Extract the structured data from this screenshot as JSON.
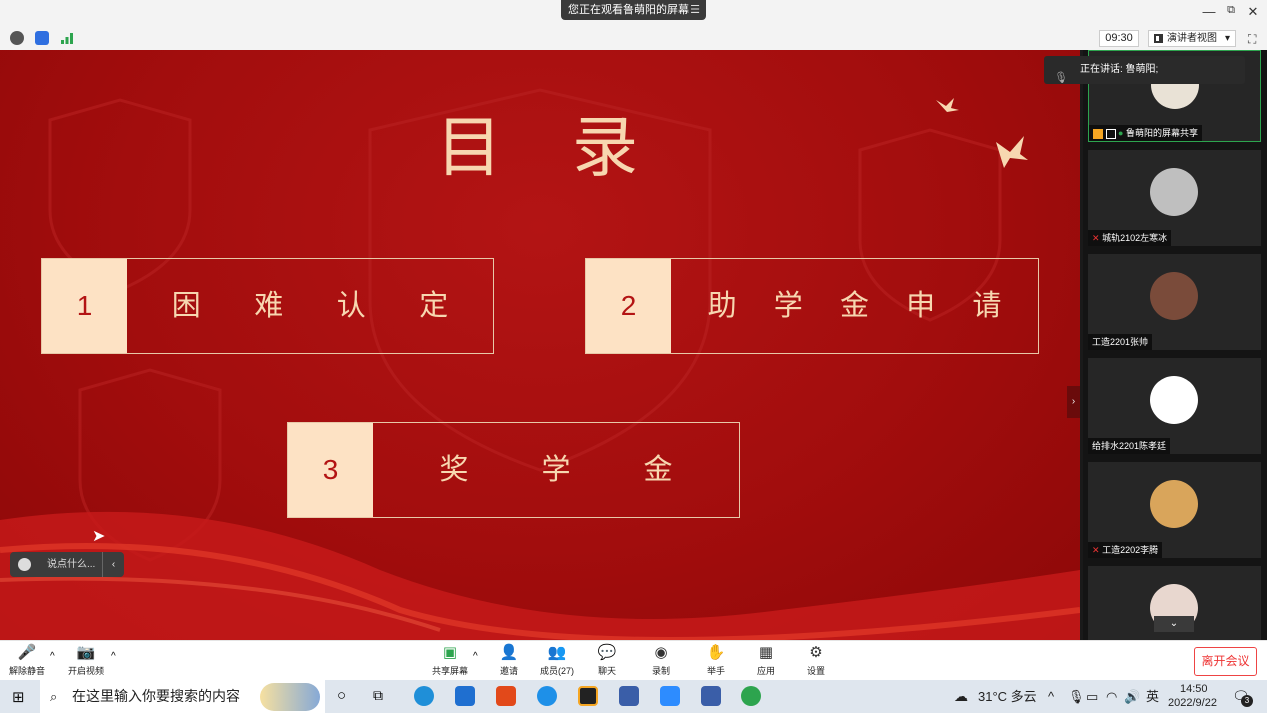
{
  "window": {
    "share_banner": "您正在观看鲁萌阳的屏幕",
    "share_menu": "☰",
    "minimize": "—",
    "restore": "⧉",
    "close": "✕"
  },
  "toolbar": {
    "timer": "09:30",
    "view_mode": "演讲者视图",
    "view_caret": "▾",
    "fullscreen": "⛶"
  },
  "slide": {
    "title": "目录",
    "items": [
      {
        "num": "1",
        "chars": [
          "困",
          "难",
          "认",
          "定"
        ]
      },
      {
        "num": "2",
        "chars": [
          "助",
          "学",
          "金",
          "申",
          "请"
        ]
      },
      {
        "num": "3",
        "chars": [
          "奖",
          "学",
          "金"
        ]
      }
    ],
    "chat_placeholder": "说点什么...",
    "chat_chevron": "‹",
    "side_toggle": "›"
  },
  "speaker": {
    "label": "正在讲话: 鲁萌阳;"
  },
  "participants": [
    {
      "name": "鲁萌阳的屏幕共享",
      "color": "#e9e2d6"
    },
    {
      "name": "城轨2102左寒冰",
      "color": "#bfbfbf"
    },
    {
      "name": "工造2201张帅",
      "color": "#7a4b3a"
    },
    {
      "name": "给排水2201陈孝廷",
      "color": "#ffffff"
    },
    {
      "name": "工造2202李腾",
      "color": "#d9a55b"
    },
    {
      "name": "",
      "color": "#e8d7cf"
    }
  ],
  "controls": {
    "mute": "解除静音",
    "video": "开启视频",
    "share": "共享屏幕",
    "invite": "邀请",
    "members": "成员(27)",
    "chat": "聊天",
    "record": "录制",
    "raise_hand": "举手",
    "apps": "应用",
    "settings": "设置",
    "leave": "离开会议"
  },
  "taskbar": {
    "search_placeholder": "在这里输入你要搜索的内容",
    "weather": "31°C 多云",
    "ime": "英",
    "time": "14:50",
    "date": "2022/9/22",
    "notifications": "3"
  },
  "colors": {
    "slide_red": "#a60f0f",
    "cream": "#fde2c4",
    "gold_text": "#f7d7b0",
    "leave_red": "#e33333"
  }
}
